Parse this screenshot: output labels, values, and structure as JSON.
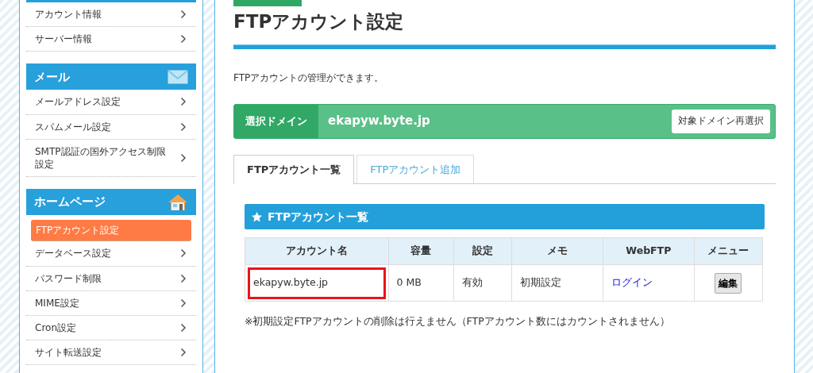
{
  "sidebar": {
    "sections": [
      {
        "items": [
          {
            "label": "アカウント情報",
            "selected": false
          },
          {
            "label": "サーバー情報",
            "selected": false
          }
        ]
      },
      {
        "title": "メール",
        "items": [
          {
            "label": "メールアドレス設定",
            "selected": false
          },
          {
            "label": "スパムメール設定",
            "selected": false
          },
          {
            "label": "SMTP認証の国外アクセス制限設定",
            "selected": false
          }
        ]
      },
      {
        "title": "ホームページ",
        "items": [
          {
            "label": "FTPアカウント設定",
            "selected": true
          },
          {
            "label": "データベース設定",
            "selected": false
          },
          {
            "label": "パスワード制限",
            "selected": false
          },
          {
            "label": "MIME設定",
            "selected": false
          },
          {
            "label": "Cron設定",
            "selected": false
          },
          {
            "label": "サイト転送設定",
            "selected": false
          }
        ]
      }
    ]
  },
  "page": {
    "title": "FTPアカウント設定",
    "description": "FTPアカウントの管理ができます。"
  },
  "domain_bar": {
    "label": "選択ドメイン",
    "domain": "ekapyw.byte.jp",
    "button": "対象ドメイン再選択"
  },
  "tabs": [
    {
      "label": "FTPアカウント一覧",
      "selected": true
    },
    {
      "label": "FTPアカウント追加",
      "selected": false
    }
  ],
  "panel": {
    "title": "FTPアカウント一覧"
  },
  "table": {
    "columns": [
      "アカウント名",
      "容量",
      "設定",
      "メモ",
      "WebFTP",
      "メニュー"
    ],
    "rows": [
      {
        "cells": [
          {
            "kind": "text",
            "text": "ekapyw.byte.jp",
            "highlighted": true
          },
          {
            "kind": "text",
            "text": "0 MB",
            "highlighted": false
          },
          {
            "kind": "text",
            "text": "有効",
            "highlighted": false
          },
          {
            "kind": "text",
            "text": "初期設定",
            "highlighted": false
          },
          {
            "kind": "link",
            "text": "ログイン",
            "highlighted": false
          },
          {
            "kind": "button",
            "text": "編集",
            "highlighted": false
          }
        ]
      }
    ]
  },
  "note": "※初期設定FTPアカウントの削除は行えません（FTPアカウント数にはカウントされません）"
}
